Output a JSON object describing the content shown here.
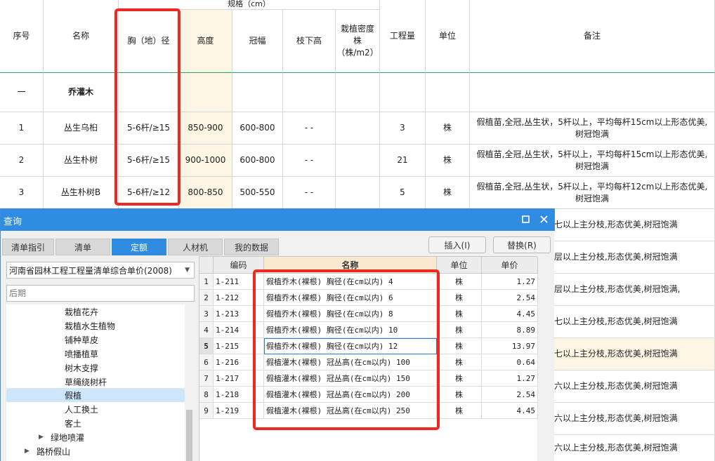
{
  "sheet": {
    "header": {
      "spec_group": "规格（cm）",
      "no": "序号",
      "name": "名称",
      "dbh": "胸（地）径",
      "height": "高度",
      "crown": "冠幅",
      "clear_trunk": "枝下高",
      "density": "栽植密度株（株/m2）",
      "qty": "工程量",
      "unit": "单位",
      "remark": "备注"
    },
    "section": {
      "no": "一",
      "name": "乔灌木"
    },
    "rows": [
      {
        "no": "1",
        "name": "丛生乌桕",
        "dbh": "5-6杆/≥15",
        "height": "850-900",
        "crown": "600-800",
        "clear_trunk": "- -",
        "qty": "3",
        "unit": "株",
        "remark": "假植苗,全冠,丛生状，5杆以上，平均每杆15cm以上形态优美,树冠饱满"
      },
      {
        "no": "2",
        "name": "丛生朴树",
        "dbh": "5-6杆/≥15",
        "height": "900-1000",
        "crown": "600-800",
        "clear_trunk": "- -",
        "qty": "21",
        "unit": "株",
        "remark": "假植苗,全冠,丛生状，5杆以上，平均每杆15cm以上形态优美,树冠饱满"
      },
      {
        "no": "3",
        "name": "丛生朴树B",
        "dbh": "5-6杆/≥12",
        "height": "800-850",
        "crown": "500-550",
        "clear_trunk": "- -",
        "qty": "5",
        "unit": "株",
        "remark": "假植苗,全冠,丛生状，5杆以上，平均每杆12cm以上形态优美,树冠饱满"
      }
    ],
    "remark_fragments": [
      "七以上主分枝,形态优美,树冠饱满",
      "层以上主分枝,形态优美,树冠饱满",
      "层以上主分枝,形态优美,树冠饱满,",
      "七以上主分枝,形态优美,树冠饱满",
      "七以上主分枝,形态优美,树冠饱满",
      "六以上主分枝,形态优美,树冠饱满",
      "六以上主分枝,形态优美,树冠饱满",
      "六以上主分枝,形态优美,树冠饱满"
    ]
  },
  "dialog": {
    "title": "查询",
    "tabs": [
      "清单指引",
      "清单",
      "定额",
      "人材机",
      "我的数据"
    ],
    "active_tab": "定额",
    "insert_label": "插入(I)",
    "replace_label": "替换(R)",
    "library": "河南省园林工程工程量清单综合单价(2008)",
    "filter_placeholder": "后期",
    "tree": [
      {
        "label": "栽植花卉"
      },
      {
        "label": "栽植水生植物"
      },
      {
        "label": "铺种草皮"
      },
      {
        "label": "喷播植草"
      },
      {
        "label": "树木支撑"
      },
      {
        "label": "草绳绕树杆"
      },
      {
        "label": "假植",
        "selected": true
      },
      {
        "label": "人工换土"
      },
      {
        "label": "客土"
      },
      {
        "label": "绿地喷灌",
        "expander": "▶"
      },
      {
        "label": "路桥假山",
        "expander": "▶"
      }
    ],
    "grid": {
      "headers": {
        "code": "编码",
        "name": "名称",
        "unit": "单位",
        "price": "单价"
      },
      "rows": [
        {
          "idx": "1",
          "code": "1-211",
          "name": "假植乔木(裸根) 胸径(在cm以内) 4",
          "unit": "株",
          "price": "1.27"
        },
        {
          "idx": "2",
          "code": "1-212",
          "name": "假植乔木(裸根) 胸径(在cm以内) 6",
          "unit": "株",
          "price": "2.54"
        },
        {
          "idx": "3",
          "code": "1-213",
          "name": "假植乔木(裸根) 胸径(在cm以内) 8",
          "unit": "株",
          "price": "4.45"
        },
        {
          "idx": "4",
          "code": "1-214",
          "name": "假植乔木(裸根) 胸径(在cm以内) 10",
          "unit": "株",
          "price": "8.89"
        },
        {
          "idx": "5",
          "code": "1-215",
          "name": "假植乔木(裸根) 胸径(在cm以内) 12",
          "unit": "株",
          "price": "13.97"
        },
        {
          "idx": "6",
          "code": "1-216",
          "name": "假植灌木(裸根) 冠丛高(在cm以内) 100",
          "unit": "株",
          "price": "0.64"
        },
        {
          "idx": "7",
          "code": "1-217",
          "name": "假植灌木(裸根) 冠丛高(在cm以内) 150",
          "unit": "株",
          "price": "1.27"
        },
        {
          "idx": "8",
          "code": "1-218",
          "name": "假植灌木(裸根) 冠丛高(在cm以内) 200",
          "unit": "株",
          "price": "2.54"
        },
        {
          "idx": "9",
          "code": "1-219",
          "name": "假植灌木(裸根) 冠丛高(在cm以内) 250",
          "unit": "株",
          "price": "4.45"
        }
      ]
    }
  },
  "colors": {
    "title_bar": "#2f8ce0",
    "highlight_box": "#ec2a24",
    "column_highlight": "#fdf5e4",
    "header_accent": "#fbe9cf",
    "tree_selection": "#cde6fb"
  }
}
